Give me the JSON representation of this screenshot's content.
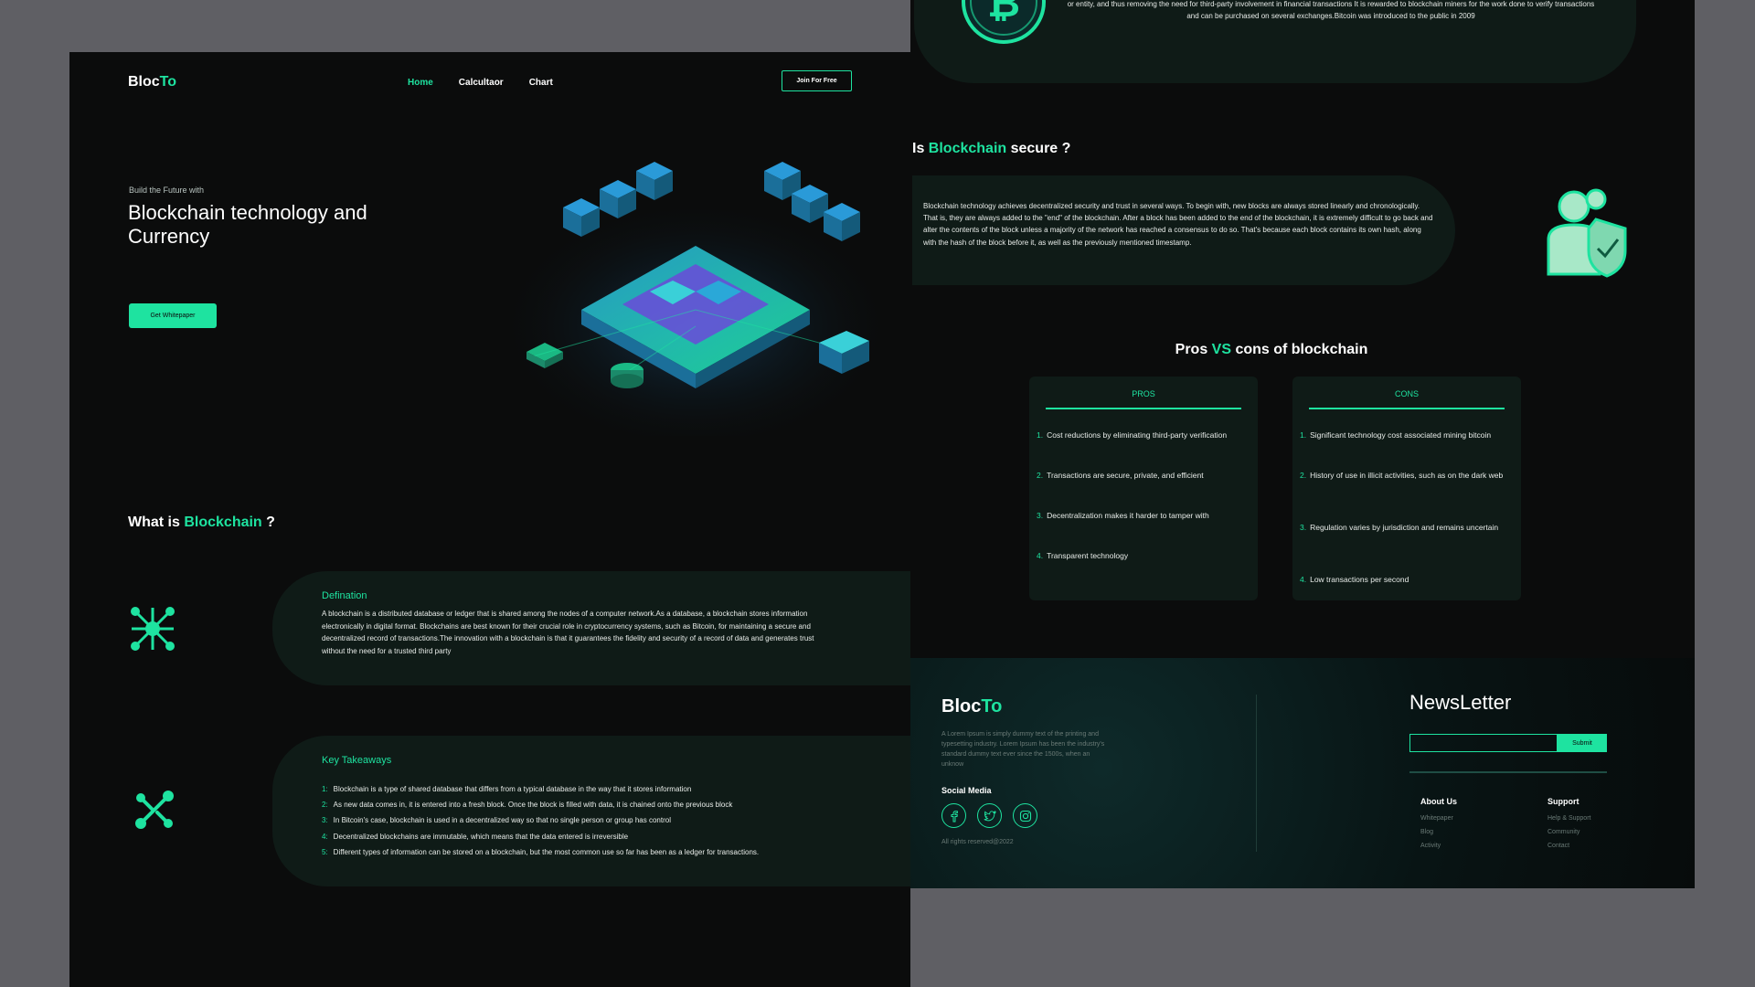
{
  "nav": {
    "logo_a": "Bloc",
    "logo_b": "To",
    "links": [
      "Home",
      "Calcultaor",
      "Chart"
    ],
    "join": "Join For Free"
  },
  "hero": {
    "subtitle": "Build the Future with",
    "title": "Blockchain technology and Currency",
    "button": "Get Whitepaper"
  },
  "what": {
    "title_a": "What is ",
    "title_b": "Blockchain",
    "title_c": " ?",
    "def_head": "Defination",
    "def_text": "A blockchain is a distributed database or ledger that is shared among the nodes of a computer network.As a database, a blockchain stores information electronically in digital format. Blockchains are best known for their crucial role in cryptocurrency systems, such as Bitcoin, for maintaining a secure and decentralized record of transactions.The innovation with a blockchain is that it guarantees the fidelity and security of a record of data and generates trust without the need for a trusted third party",
    "kt_head": "Key Takeaways",
    "kt_nums": [
      "1:",
      "2:",
      "3:",
      "4:",
      "5:"
    ],
    "kt_items": [
      "Blockchain is a type of shared database that differs from a typical database in the way that it stores information",
      "As new data comes in, it is entered into a fresh block. Once the block is filled with data, it is chained onto the previous block",
      "In Bitcoin's case, blockchain is used in a decentralized way so that no single person or group has control",
      "Decentralized blockchains are immutable, which means that the data entered is irreversible",
      "Different types of information can be stored on a blockchain, but the most common use so far has been as a ledger for transactions."
    ]
  },
  "bitcoin": {
    "text": "or entity, and thus removing the need for third-party involvement in financial transactions It is rewarded to blockchain miners for the work done to verify transactions and can be purchased on several exchanges.Bitcoin was introduced to the public in 2009"
  },
  "secure": {
    "title_a": "Is ",
    "title_b": "Blockchain",
    "title_c": " secure ?",
    "text": "Blockchain technology achieves decentralized security and trust in several ways. To begin with, new blocks are always stored linearly and chronologically. That is, they are always added to the \"end\" of the blockchain. After a block has been added to the end of the blockchain, it is extremely difficult to go back and alter the contents of the block unless a majority of the network has reached a consensus to do so. That's because each block contains its own hash, along with the hash of the block before it, as well as the previously mentioned timestamp."
  },
  "proscons": {
    "title_a": "Pros ",
    "title_b": "VS",
    "title_c": " cons of blockchain",
    "pros_head": "PROS",
    "cons_head": "CONS",
    "nums": [
      "1.",
      "2.",
      "3.",
      "4."
    ],
    "pros": [
      "Cost reductions by eliminating third-party verification",
      "Transactions are secure, private, and efficient",
      "Decentralization makes it harder to tamper with",
      "Transparent technology"
    ],
    "cons": [
      "Significant technology cost associated mining bitcoin",
      "History of use in illicit activities, such as on the dark web",
      "Regulation varies by jurisdiction and remains uncertain",
      "Low transactions per second"
    ]
  },
  "footer": {
    "logo_a": "Bloc",
    "logo_b": "To",
    "desc": "A Lorem Ipsum is simply dummy text of the printing and typesetting industry. Lorem Ipsum has been the industry's standard dummy text ever since the 1500s, when an unknow",
    "social_title": "Social Media",
    "rights": "All rights reserved@2022",
    "newsletter": "NewsLetter",
    "submit": "Submit",
    "about_head": "About Us",
    "about_links": [
      "Whitepaper",
      "Blog",
      "Activity"
    ],
    "support_head": "Support",
    "support_links": [
      "Help & Support",
      "Community",
      "Contact"
    ]
  },
  "colors": {
    "accent": "#1ee3a0",
    "background": "#0b0c0c",
    "card": "#0f1b17"
  }
}
